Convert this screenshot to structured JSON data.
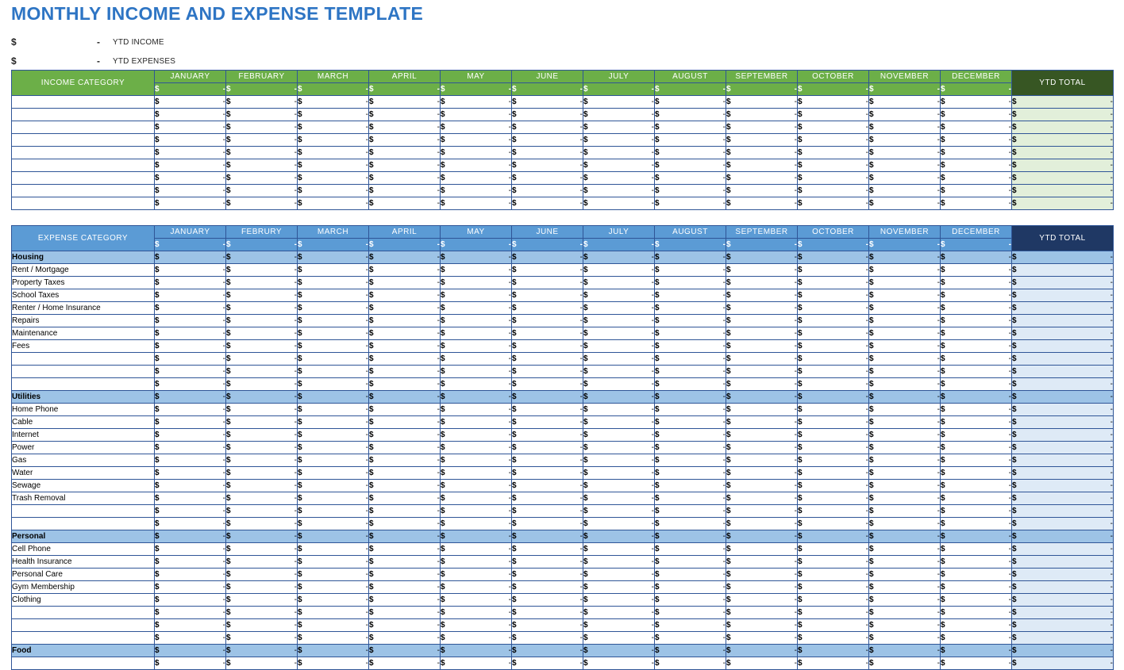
{
  "page": {
    "title": "MONTHLY INCOME AND EXPENSE TEMPLATE",
    "title_color": "#2E75C4"
  },
  "summary": {
    "rows": [
      {
        "currency": "$",
        "value": "-",
        "label": "YTD INCOME"
      },
      {
        "currency": "$",
        "value": "-",
        "label": "YTD EXPENSES"
      }
    ]
  },
  "income_table": {
    "category_header": "INCOME CATEGORY",
    "months": [
      "JANUARY",
      "FEBRUARY",
      "MARCH",
      "APRIL",
      "MAY",
      "JUNE",
      "JULY",
      "AUGUST",
      "SEPTEMBER",
      "OCTOBER",
      "NOVEMBER",
      "DECEMBER"
    ],
    "ytd_header": "YTD TOTAL",
    "currency": "$",
    "empty_value": "-",
    "header_color": "#6CAF48",
    "ytd_header_color": "#375623",
    "ytd_cell_color": "#E2EFDA",
    "totals_row": {
      "months": [
        "-",
        "-",
        "-",
        "-",
        "-",
        "-",
        "-",
        "-",
        "-",
        "-",
        "-",
        "-"
      ],
      "ytd": "-"
    },
    "rows": [
      {
        "label": "",
        "months": [
          "-",
          "-",
          "-",
          "-",
          "-",
          "-",
          "-",
          "-",
          "-",
          "-",
          "-",
          "-"
        ],
        "ytd": "-"
      },
      {
        "label": "",
        "months": [
          "-",
          "-",
          "-",
          "-",
          "-",
          "-",
          "-",
          "-",
          "-",
          "-",
          "-",
          "-"
        ],
        "ytd": "-"
      },
      {
        "label": "",
        "months": [
          "-",
          "-",
          "-",
          "-",
          "-",
          "-",
          "-",
          "-",
          "-",
          "-",
          "-",
          "-"
        ],
        "ytd": "-"
      },
      {
        "label": "",
        "months": [
          "-",
          "-",
          "-",
          "-",
          "-",
          "-",
          "-",
          "-",
          "-",
          "-",
          "-",
          "-"
        ],
        "ytd": "-"
      },
      {
        "label": "",
        "months": [
          "-",
          "-",
          "-",
          "-",
          "-",
          "-",
          "-",
          "-",
          "-",
          "-",
          "-",
          "-"
        ],
        "ytd": "-"
      },
      {
        "label": "",
        "months": [
          "-",
          "-",
          "-",
          "-",
          "-",
          "-",
          "-",
          "-",
          "-",
          "-",
          "-",
          "-"
        ],
        "ytd": "-"
      },
      {
        "label": "",
        "months": [
          "-",
          "-",
          "-",
          "-",
          "-",
          "-",
          "-",
          "-",
          "-",
          "-",
          "-",
          "-"
        ],
        "ytd": "-"
      },
      {
        "label": "",
        "months": [
          "-",
          "-",
          "-",
          "-",
          "-",
          "-",
          "-",
          "-",
          "-",
          "-",
          "-",
          "-"
        ],
        "ytd": "-"
      },
      {
        "label": "",
        "months": [
          "-",
          "-",
          "-",
          "-",
          "-",
          "-",
          "-",
          "-",
          "-",
          "-",
          "-",
          "-"
        ],
        "ytd": "-"
      }
    ]
  },
  "expense_table": {
    "category_header": "EXPENSE CATEGORY",
    "months": [
      "JANUARY",
      "FEBRURY",
      "MARCH",
      "APRIL",
      "MAY",
      "JUNE",
      "JULY",
      "AUGUST",
      "SEPTEMBER",
      "OCTOBER",
      "NOVEMBER",
      "DECEMBER"
    ],
    "ytd_header": "YTD TOTAL",
    "currency": "$",
    "empty_value": "-",
    "header_color": "#5B9BD5",
    "ytd_header_color": "#1F3864",
    "ytd_cell_color": "#DEEAF6",
    "section_color": "#9DC3E6",
    "totals_row": {
      "months": [
        "-",
        "-",
        "-",
        "-",
        "-",
        "-",
        "-",
        "-",
        "-",
        "-",
        "-",
        "-"
      ],
      "ytd": "-"
    },
    "rows": [
      {
        "label": "Housing",
        "section": true,
        "months": [
          "-",
          "-",
          "-",
          "-",
          "-",
          "-",
          "-",
          "-",
          "-",
          "-",
          "-",
          "-"
        ],
        "ytd": "-"
      },
      {
        "label": "Rent / Mortgage",
        "section": false,
        "months": [
          "-",
          "-",
          "-",
          "-",
          "-",
          "-",
          "-",
          "-",
          "-",
          "-",
          "-",
          "-"
        ],
        "ytd": "-"
      },
      {
        "label": "Property Taxes",
        "section": false,
        "months": [
          "-",
          "-",
          "-",
          "-",
          "-",
          "-",
          "-",
          "-",
          "-",
          "-",
          "-",
          "-"
        ],
        "ytd": "-"
      },
      {
        "label": "School Taxes",
        "section": false,
        "months": [
          "-",
          "-",
          "-",
          "-",
          "-",
          "-",
          "-",
          "-",
          "-",
          "-",
          "-",
          "-"
        ],
        "ytd": "-"
      },
      {
        "label": "Renter / Home Insurance",
        "section": false,
        "months": [
          "-",
          "-",
          "-",
          "-",
          "-",
          "-",
          "-",
          "-",
          "-",
          "-",
          "-",
          "-"
        ],
        "ytd": "-"
      },
      {
        "label": "Repairs",
        "section": false,
        "months": [
          "-",
          "-",
          "-",
          "-",
          "-",
          "-",
          "-",
          "-",
          "-",
          "-",
          "-",
          "-"
        ],
        "ytd": "-"
      },
      {
        "label": "Maintenance",
        "section": false,
        "months": [
          "-",
          "-",
          "-",
          "-",
          "-",
          "-",
          "-",
          "-",
          "-",
          "-",
          "-",
          "-"
        ],
        "ytd": "-"
      },
      {
        "label": "Fees",
        "section": false,
        "months": [
          "-",
          "-",
          "-",
          "-",
          "-",
          "-",
          "-",
          "-",
          "-",
          "-",
          "-",
          "-"
        ],
        "ytd": "-"
      },
      {
        "label": "",
        "section": false,
        "months": [
          "-",
          "-",
          "-",
          "-",
          "-",
          "-",
          "-",
          "-",
          "-",
          "-",
          "-",
          "-"
        ],
        "ytd": "-"
      },
      {
        "label": "",
        "section": false,
        "months": [
          "-",
          "-",
          "-",
          "-",
          "-",
          "-",
          "-",
          "-",
          "-",
          "-",
          "-",
          "-"
        ],
        "ytd": "-"
      },
      {
        "label": "",
        "section": false,
        "months": [
          "-",
          "-",
          "-",
          "-",
          "-",
          "-",
          "-",
          "-",
          "-",
          "-",
          "-",
          "-"
        ],
        "ytd": "-"
      },
      {
        "label": "Utilities",
        "section": true,
        "months": [
          "-",
          "-",
          "-",
          "-",
          "-",
          "-",
          "-",
          "-",
          "-",
          "-",
          "-",
          "-"
        ],
        "ytd": "-"
      },
      {
        "label": "Home Phone",
        "section": false,
        "months": [
          "-",
          "-",
          "-",
          "-",
          "-",
          "-",
          "-",
          "-",
          "-",
          "-",
          "-",
          "-"
        ],
        "ytd": "-"
      },
      {
        "label": "Cable",
        "section": false,
        "months": [
          "-",
          "-",
          "-",
          "-",
          "-",
          "-",
          "-",
          "-",
          "-",
          "-",
          "-",
          "-"
        ],
        "ytd": "-"
      },
      {
        "label": "Internet",
        "section": false,
        "months": [
          "-",
          "-",
          "-",
          "-",
          "-",
          "-",
          "-",
          "-",
          "-",
          "-",
          "-",
          "-"
        ],
        "ytd": "-"
      },
      {
        "label": "Power",
        "section": false,
        "months": [
          "-",
          "-",
          "-",
          "-",
          "-",
          "-",
          "-",
          "-",
          "-",
          "-",
          "-",
          "-"
        ],
        "ytd": "-"
      },
      {
        "label": "Gas",
        "section": false,
        "months": [
          "-",
          "-",
          "-",
          "-",
          "-",
          "-",
          "-",
          "-",
          "-",
          "-",
          "-",
          "-"
        ],
        "ytd": "-"
      },
      {
        "label": "Water",
        "section": false,
        "months": [
          "-",
          "-",
          "-",
          "-",
          "-",
          "-",
          "-",
          "-",
          "-",
          "-",
          "-",
          "-"
        ],
        "ytd": "-"
      },
      {
        "label": "Sewage",
        "section": false,
        "months": [
          "-",
          "-",
          "-",
          "-",
          "-",
          "-",
          "-",
          "-",
          "-",
          "-",
          "-",
          "-"
        ],
        "ytd": "-"
      },
      {
        "label": "Trash Removal",
        "section": false,
        "months": [
          "-",
          "-",
          "-",
          "-",
          "-",
          "-",
          "-",
          "-",
          "-",
          "-",
          "-",
          "-"
        ],
        "ytd": "-"
      },
      {
        "label": "",
        "section": false,
        "months": [
          "-",
          "-",
          "-",
          "-",
          "-",
          "-",
          "-",
          "-",
          "-",
          "-",
          "-",
          "-"
        ],
        "ytd": "-"
      },
      {
        "label": "",
        "section": false,
        "months": [
          "-",
          "-",
          "-",
          "-",
          "-",
          "-",
          "-",
          "-",
          "-",
          "-",
          "-",
          "-"
        ],
        "ytd": "-"
      },
      {
        "label": "Personal",
        "section": true,
        "months": [
          "-",
          "-",
          "-",
          "-",
          "-",
          "-",
          "-",
          "-",
          "-",
          "-",
          "-",
          "-"
        ],
        "ytd": "-"
      },
      {
        "label": "Cell Phone",
        "section": false,
        "months": [
          "-",
          "-",
          "-",
          "-",
          "-",
          "-",
          "-",
          "-",
          "-",
          "-",
          "-",
          "-"
        ],
        "ytd": "-"
      },
      {
        "label": "Health Insurance",
        "section": false,
        "months": [
          "-",
          "-",
          "-",
          "-",
          "-",
          "-",
          "-",
          "-",
          "-",
          "-",
          "-",
          "-"
        ],
        "ytd": "-"
      },
      {
        "label": "Personal Care",
        "section": false,
        "months": [
          "-",
          "-",
          "-",
          "-",
          "-",
          "-",
          "-",
          "-",
          "-",
          "-",
          "-",
          "-"
        ],
        "ytd": "-"
      },
      {
        "label": "Gym Membership",
        "section": false,
        "months": [
          "-",
          "-",
          "-",
          "-",
          "-",
          "-",
          "-",
          "-",
          "-",
          "-",
          "-",
          "-"
        ],
        "ytd": "-"
      },
      {
        "label": "Clothing",
        "section": false,
        "months": [
          "-",
          "-",
          "-",
          "-",
          "-",
          "-",
          "-",
          "-",
          "-",
          "-",
          "-",
          "-"
        ],
        "ytd": "-"
      },
      {
        "label": "",
        "section": false,
        "months": [
          "-",
          "-",
          "-",
          "-",
          "-",
          "-",
          "-",
          "-",
          "-",
          "-",
          "-",
          "-"
        ],
        "ytd": "-"
      },
      {
        "label": "",
        "section": false,
        "months": [
          "-",
          "-",
          "-",
          "-",
          "-",
          "-",
          "-",
          "-",
          "-",
          "-",
          "-",
          "-"
        ],
        "ytd": "-"
      },
      {
        "label": "",
        "section": false,
        "months": [
          "-",
          "-",
          "-",
          "-",
          "-",
          "-",
          "-",
          "-",
          "-",
          "-",
          "-",
          "-"
        ],
        "ytd": "-"
      },
      {
        "label": "Food",
        "section": true,
        "months": [
          "-",
          "-",
          "-",
          "-",
          "-",
          "-",
          "-",
          "-",
          "-",
          "-",
          "-",
          "-"
        ],
        "ytd": "-"
      },
      {
        "label": "",
        "section": false,
        "months": [
          "-",
          "-",
          "-",
          "-",
          "-",
          "-",
          "-",
          "-",
          "-",
          "-",
          "-",
          "-"
        ],
        "ytd": "-"
      }
    ]
  }
}
